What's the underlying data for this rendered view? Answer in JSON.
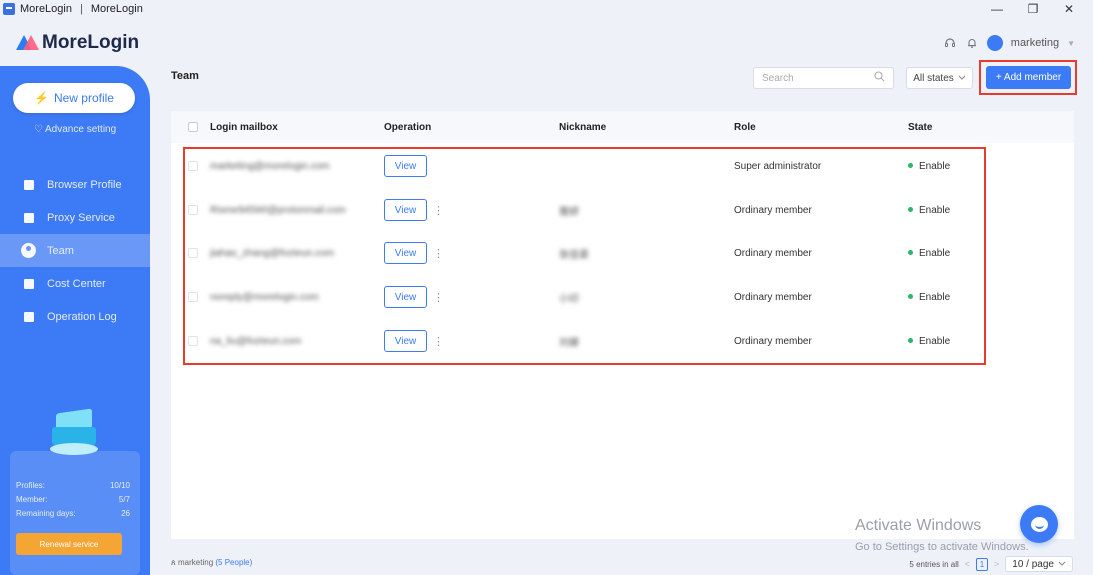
{
  "window": {
    "app_name": "MoreLogin",
    "separator": "|",
    "window_title": "MoreLogin",
    "controls": {
      "minimize": "—",
      "restore": "❐",
      "close": "✕"
    }
  },
  "header": {
    "logo_text": "MoreLogin",
    "user_name": "marketing",
    "icons": [
      "headset-icon",
      "bell-icon",
      "avatar"
    ]
  },
  "sidebar": {
    "new_profile_label": "New profile",
    "advance_setting_label": "Advance setting",
    "items": [
      {
        "label": "Browser Profile",
        "icon": "browser-icon",
        "active": false
      },
      {
        "label": "Proxy Service",
        "icon": "proxy-icon",
        "active": false
      },
      {
        "label": "Team",
        "icon": "team-icon",
        "active": true
      },
      {
        "label": "Cost Center",
        "icon": "wallet-icon",
        "active": false
      },
      {
        "label": "Operation Log",
        "icon": "log-icon",
        "active": false
      }
    ],
    "stats": [
      {
        "label": "Profiles:",
        "value": "10/10"
      },
      {
        "label": "Member:",
        "value": "5/7"
      },
      {
        "label": "Remaining days:",
        "value": "26"
      }
    ],
    "renew_label": "Renewal service"
  },
  "main": {
    "title": "Team",
    "search_placeholder": "Search",
    "states_label": "All states",
    "add_member_label": "+ Add member",
    "columns": [
      "Login mailbox",
      "Operation",
      "Nickname",
      "Role",
      "State"
    ],
    "rows": [
      {
        "mailbox": "marketing@morelogin.com",
        "view": "View",
        "more": false,
        "nickname": "",
        "role": "Super administrator",
        "state": "Enable"
      },
      {
        "mailbox": "Risme945WI@protonmail.com",
        "view": "View",
        "more": true,
        "nickname": "雅妍",
        "role": "Ordinary member",
        "state": "Enable"
      },
      {
        "mailbox": "jiahao_zhang@fozteun.com",
        "view": "View",
        "more": true,
        "nickname": "张佳豪",
        "role": "Ordinary member",
        "state": "Enable"
      },
      {
        "mailbox": "noreply@morelogin.com",
        "view": "View",
        "more": true,
        "nickname": "小印",
        "role": "Ordinary member",
        "state": "Enable"
      },
      {
        "mailbox": "na_liu@fozteun.com",
        "view": "View",
        "more": true,
        "nickname": "刘娜",
        "role": "Ordinary member",
        "state": "Enable"
      }
    ]
  },
  "footer": {
    "team_name": "marketing",
    "people_count": "(5 People)",
    "entries": "5 entries in all",
    "current_page": "1",
    "page_size": "10 / page"
  },
  "overlay": {
    "activate_title": "Activate Windows",
    "activate_sub": "Go to Settings to activate Windows."
  },
  "colors": {
    "accent": "#3d7af5",
    "highlight": "#e83a2d",
    "enable": "#2fb566",
    "renew": "#f5a533"
  }
}
